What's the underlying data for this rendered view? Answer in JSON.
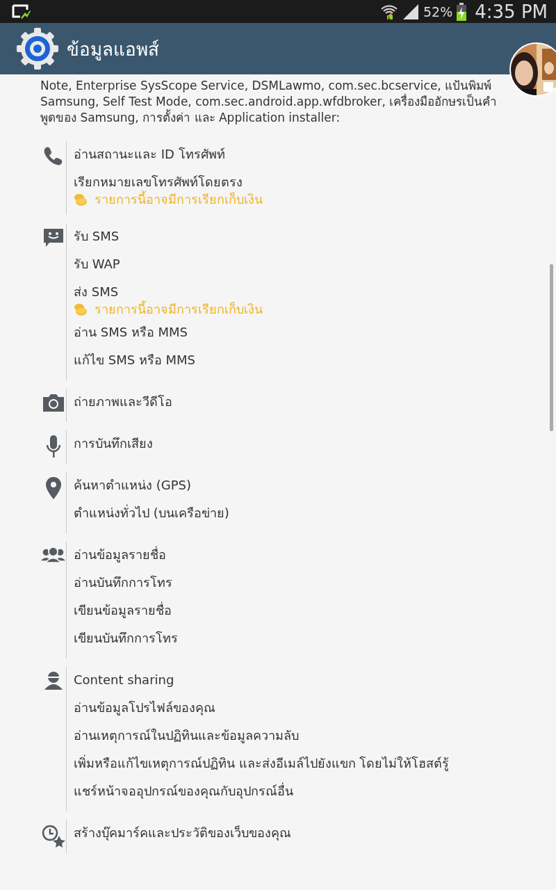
{
  "status_bar": {
    "battery_percent": "52%",
    "time": "4:35 PM"
  },
  "header": {
    "title": "ข้อมูลแอพส์"
  },
  "intro": "Note, Enterprise SysScope Service, DSMLawmo, com.sec.bcservice, แป้นพิมพ์ Samsung, Self Test Mode, com.sec.android.app.wfdbroker, เครื่องมืออักษรเป็นคำพูดของ Samsung, การตั้งค่า และ Application installer:",
  "groups": [
    {
      "kind": "phone",
      "items": [
        {
          "kind": "permission",
          "text": "อ่านสถานะและ ID โทรศัพท์"
        },
        {
          "kind": "permission",
          "text": "เรียกหมายเลขโทรศัพท์โดยตรง"
        },
        {
          "kind": "charge",
          "text": "รายการนี้อาจมีการเรียกเก็บเงิน"
        }
      ]
    },
    {
      "kind": "message",
      "items": [
        {
          "kind": "permission",
          "text": "รับ SMS"
        },
        {
          "kind": "permission",
          "text": "รับ WAP"
        },
        {
          "kind": "permission",
          "text": "ส่ง SMS"
        },
        {
          "kind": "charge",
          "text": "รายการนี้อาจมีการเรียกเก็บเงิน"
        },
        {
          "kind": "permission",
          "text": "อ่าน SMS หรือ MMS"
        },
        {
          "kind": "permission",
          "text": "แก้ไข SMS หรือ MMS"
        }
      ]
    },
    {
      "kind": "camera",
      "items": [
        {
          "kind": "permission",
          "text": "ถ่ายภาพและวีดีโอ"
        }
      ]
    },
    {
      "kind": "mic",
      "items": [
        {
          "kind": "permission",
          "text": "การบันทึกเสียง"
        }
      ]
    },
    {
      "kind": "location",
      "items": [
        {
          "kind": "permission",
          "text": "ค้นหาตำแหน่ง (GPS)"
        },
        {
          "kind": "permission",
          "text": "ตำแหน่งทั่วไป (บนเครือข่าย)"
        }
      ]
    },
    {
      "kind": "contacts",
      "items": [
        {
          "kind": "permission",
          "text": "อ่านข้อมูลรายชื่อ"
        },
        {
          "kind": "permission",
          "text": "อ่านบันทึกการโทร"
        },
        {
          "kind": "permission",
          "text": "เขียนข้อมูลรายชื่อ"
        },
        {
          "kind": "permission",
          "text": "เขียนบันทึกการโทร"
        }
      ]
    },
    {
      "kind": "person",
      "items": [
        {
          "kind": "permission",
          "text": "Content sharing"
        },
        {
          "kind": "permission",
          "text": "อ่านข้อมูลโปรไฟล์ของคุณ"
        },
        {
          "kind": "permission",
          "text": "อ่านเหตุการณ์ในปฏิทินและข้อมูลความลับ"
        },
        {
          "kind": "permission",
          "text": "เพิ่มหรือแก้ไขเหตุการณ์ปฏิทิน และส่งอีเมล์ไปยังแขก โดยไม่ให้โฮสต์รู้"
        },
        {
          "kind": "permission",
          "text": "แชร์หน้าจออุปกรณ์ของคุณกับอุปกรณ์อื่น"
        }
      ]
    },
    {
      "kind": "bookmark",
      "items": [
        {
          "kind": "permission",
          "text": "สร้างบุ๊คมาร์คและประวัติของเว็บของคุณ"
        }
      ]
    }
  ]
}
